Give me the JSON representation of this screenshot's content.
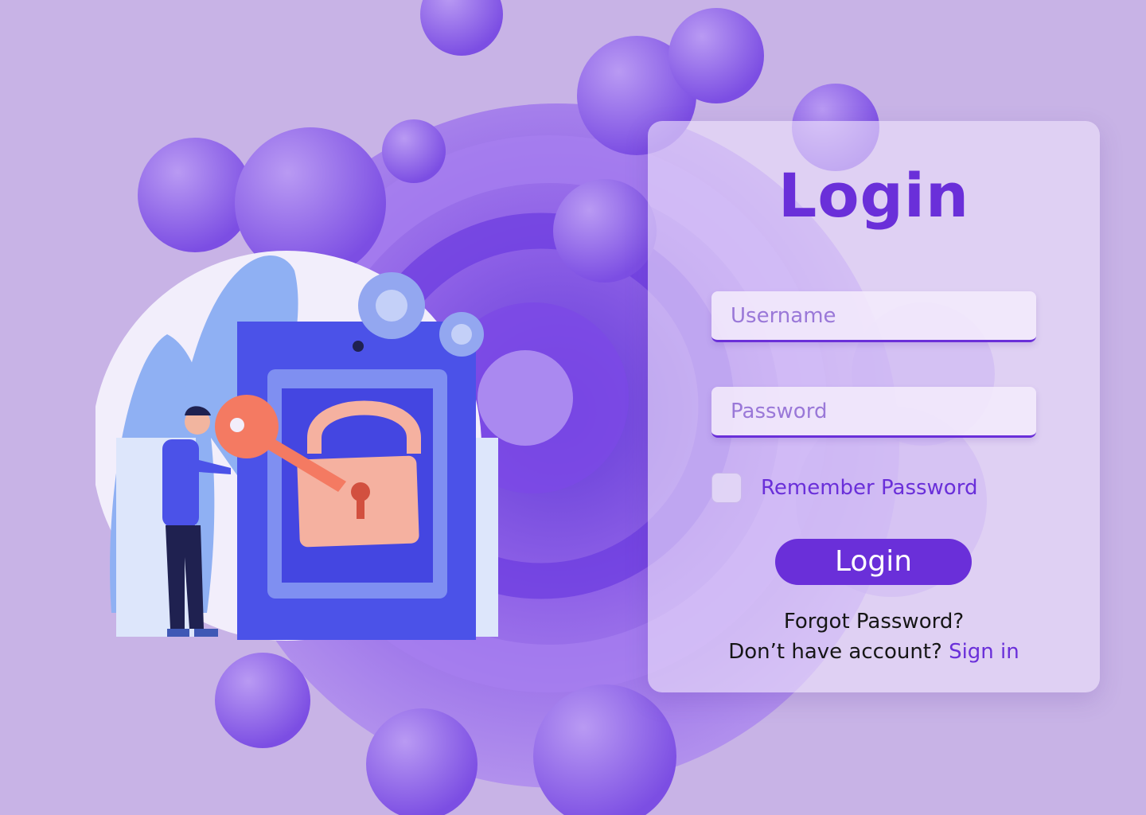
{
  "login_card": {
    "title": "Login",
    "username_placeholder": "Username",
    "password_placeholder": "Password",
    "remember_label": "Remember Password",
    "login_button": "Login",
    "forgot_password": "Forgot Password?",
    "no_account_prompt": "Don’t have account?",
    "sign_in_link": "Sign in"
  },
  "illustration": {
    "icons": [
      "gear-icon",
      "padlock-icon",
      "key-icon"
    ]
  },
  "colors": {
    "accent": "#6a2fd9",
    "background": "#c8b3e6",
    "card": "#eee2fa"
  }
}
